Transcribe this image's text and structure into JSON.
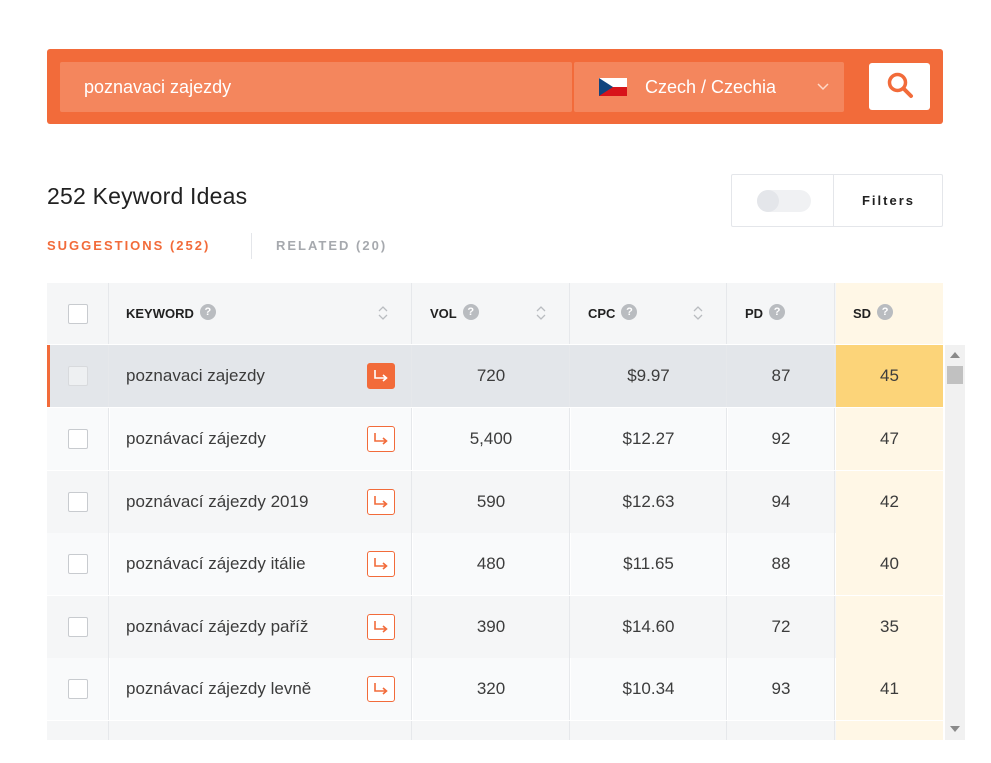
{
  "search": {
    "query": "poznavaci zajezdy",
    "country": "Czech / Czechia",
    "flag": "czech-flag-icon"
  },
  "summary": {
    "title": "252 Keyword Ideas"
  },
  "filters": {
    "label": "Filters",
    "toggle_on": false
  },
  "tabs": [
    {
      "label": "SUGGESTIONS (252)",
      "active": true
    },
    {
      "label": "RELATED (20)",
      "active": false
    }
  ],
  "table": {
    "headers": {
      "keyword": "KEYWORD",
      "vol": "VOL",
      "cpc": "CPC",
      "pd": "PD",
      "sd": "SD",
      "help": "?"
    },
    "rows": [
      {
        "keyword": "poznavaci zajezdy",
        "vol": "720",
        "cpc": "$9.97",
        "pd": "87",
        "sd": "45"
      },
      {
        "keyword": "poznávací zájezdy",
        "vol": "5,400",
        "cpc": "$12.27",
        "pd": "92",
        "sd": "47"
      },
      {
        "keyword": "poznávací zájezdy 2019",
        "vol": "590",
        "cpc": "$12.63",
        "pd": "94",
        "sd": "42"
      },
      {
        "keyword": "poznávací zájezdy itálie",
        "vol": "480",
        "cpc": "$11.65",
        "pd": "88",
        "sd": "40"
      },
      {
        "keyword": "poznávací zájezdy paříž",
        "vol": "390",
        "cpc": "$14.60",
        "pd": "72",
        "sd": "35"
      },
      {
        "keyword": "poznávací zájezdy levně",
        "vol": "320",
        "cpc": "$10.34",
        "pd": "93",
        "sd": "41"
      },
      {
        "keyword": "",
        "vol": "",
        "cpc": "",
        "pd": "",
        "sd": ""
      }
    ]
  },
  "colors": {
    "accent": "#f26b3a",
    "sd_highlight": "#fcd479",
    "sd_column": "#fff7e6"
  }
}
